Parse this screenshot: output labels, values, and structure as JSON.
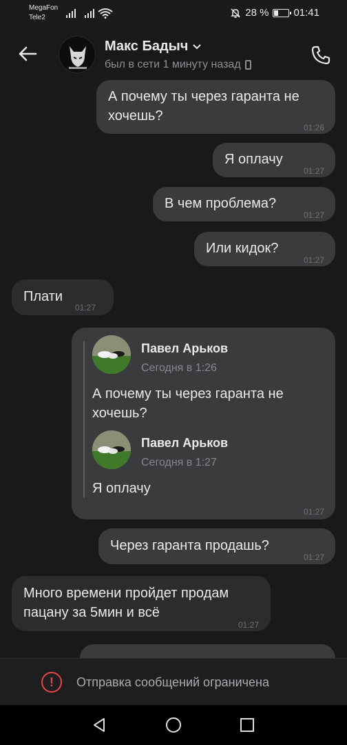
{
  "status_bar": {
    "carrier1": "MegaFon",
    "carrier2": "Tele2",
    "battery_text": "28 %",
    "battery_level": 0.28,
    "time": "01:41"
  },
  "header": {
    "contact_name": "Макс Бадыч",
    "contact_status": "был в сети 1 минуту назад"
  },
  "messages": [
    {
      "text_line1": "А почему ты через гаранта не",
      "text_line2": "хочешь?",
      "time": "01:26"
    },
    {
      "text": "Я оплачу",
      "time": "01:27"
    },
    {
      "text": "В чем проблема?",
      "time": "01:27"
    },
    {
      "text": "Или кидок?",
      "time": "01:27"
    },
    {
      "text": "Плати",
      "time": "01:27"
    },
    {
      "forwarded": [
        {
          "name": "Павел Арьков",
          "date": "Сегодня в 1:26",
          "text_line1": "А почему ты через гаранта не",
          "text_line2": "хочешь?"
        },
        {
          "name": "Павел Арьков",
          "date": "Сегодня в 1:27",
          "text": "Я оплачу"
        }
      ],
      "time": "01:27"
    },
    {
      "text": "Через гаранта продашь?",
      "time": "01:27"
    },
    {
      "text_line1": "Много времени пройдет продам",
      "text_line2": "пацану за 5мин и всё",
      "time": "01:27"
    }
  ],
  "restriction": {
    "icon": "!",
    "text": "Отправка сообщений ограничена"
  },
  "colors": {
    "background": "#19191a",
    "outgoing_bubble": "#3a3b3d",
    "incoming_bubble": "#2b2c2e",
    "warning": "#e64646"
  }
}
